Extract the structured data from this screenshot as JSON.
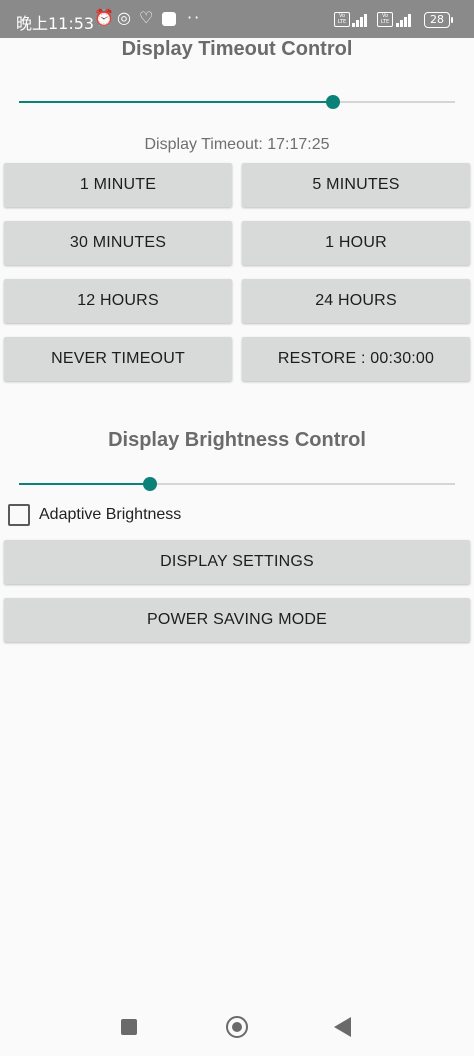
{
  "status_bar": {
    "time": "晚上11:53",
    "battery": "28",
    "volte_label": "Vo LTE",
    "icons": [
      "alarm-icon",
      "whatsapp-icon",
      "heart-rate-icon",
      "app-square-icon",
      "more-dots-icon",
      "volte-icon",
      "signal-icon",
      "battery-icon"
    ]
  },
  "timeout_section": {
    "title": "Display Timeout Control",
    "slider_level": 0.72,
    "current_label": "Display Timeout: 17:17:25",
    "buttons": [
      {
        "label": "1 MINUTE"
      },
      {
        "label": "5 MINUTES"
      },
      {
        "label": "30 MINUTES"
      },
      {
        "label": "1 HOUR"
      },
      {
        "label": "12 HOURS"
      },
      {
        "label": "24 HOURS"
      },
      {
        "label": "NEVER TIMEOUT"
      },
      {
        "label": "RESTORE : 00:30:00"
      }
    ]
  },
  "brightness_section": {
    "title": "Display Brightness Control",
    "slider_level": 0.3,
    "adaptive_label": "Adaptive Brightness",
    "adaptive_checked": false,
    "display_settings_label": "DISPLAY SETTINGS",
    "power_saving_label": "POWER SAVING MODE"
  },
  "nav_bar": {
    "icons": [
      "recents-square-icon",
      "home-circle-icon",
      "back-triangle-icon"
    ]
  },
  "colors": {
    "accent": "#0b8277",
    "button_bg": "#d8d9d9",
    "status_bar_bg": "#8a8a8a",
    "title_text": "#6b6b6b"
  }
}
